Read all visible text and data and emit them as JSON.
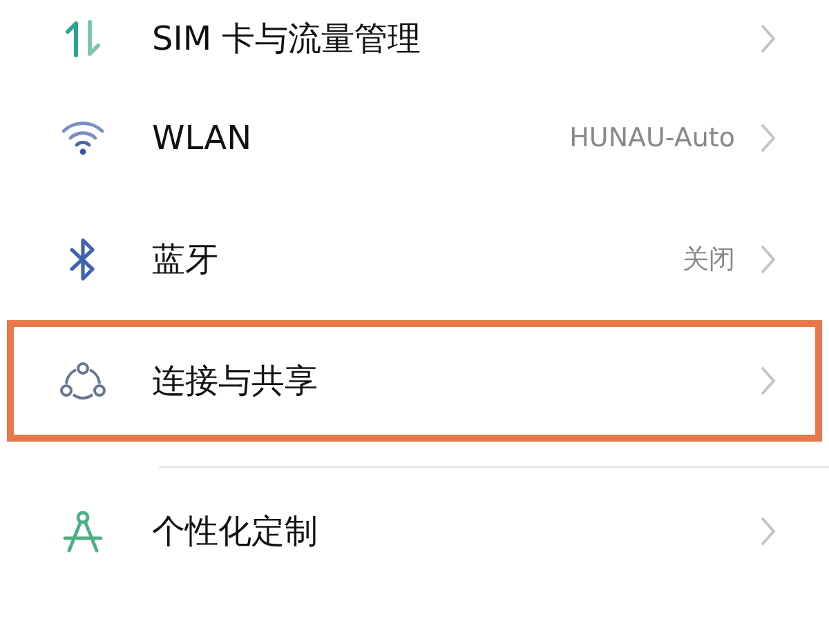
{
  "settings_groups": [
    {
      "rows": [
        {
          "label": "SIM 卡与流量管理",
          "highlighted": false
        },
        {
          "label": "WLAN",
          "value": "HUNAU-Auto",
          "highlighted": false
        },
        {
          "label": "蓝牙",
          "value": "关闭",
          "highlighted": false
        },
        {
          "label": "连接与共享",
          "highlighted": true
        }
      ]
    },
    {
      "rows": [
        {
          "label": "个性化定制",
          "highlighted": false
        }
      ]
    }
  ]
}
